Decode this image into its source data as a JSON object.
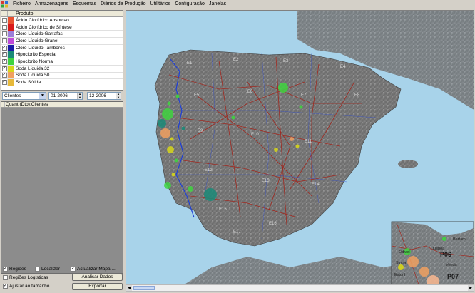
{
  "menu": {
    "items": [
      "Ficheiro",
      "Armazenagens",
      "Esquemas",
      "Diários de Produção",
      "Utilitários",
      "Configuração",
      "Janelas"
    ]
  },
  "products": {
    "header": "Produto",
    "rows": [
      {
        "label": "Ácido Clorídrico Absorcao",
        "checked": false,
        "color": "#e8512f"
      },
      {
        "label": "Ácido Clorídrico de Síntese",
        "checked": false,
        "color": "#d91a1a"
      },
      {
        "label": "Cloro Líquido Garrafas",
        "checked": false,
        "color": "#9c7fd9"
      },
      {
        "label": "Cloro Líquido Granel",
        "checked": false,
        "color": "#c04bd8"
      },
      {
        "label": "Cloro Líquido Tambores",
        "checked": true,
        "color": "#1b1ba6"
      },
      {
        "label": "Hipoclorito Especial",
        "checked": true,
        "color": "#1a8a78"
      },
      {
        "label": "Hipoclorito Normal",
        "checked": true,
        "color": "#3fd33f"
      },
      {
        "label": "Soda Líquida 32",
        "checked": true,
        "color": "#d6d61a"
      },
      {
        "label": "Soda Líquida 50",
        "checked": true,
        "color": "#f0a060"
      },
      {
        "label": "Soda Sólida",
        "checked": true,
        "color": "#e7b93a"
      }
    ]
  },
  "filter": {
    "type": "Clientes",
    "date_from": "01-2006",
    "date_to": "12-2006"
  },
  "clients_list": {
    "header": "Quant.(Dto):Clientes"
  },
  "options": {
    "regioes": {
      "label": "Regioes",
      "checked": true
    },
    "localizar": {
      "label": "Localizar",
      "checked": false
    },
    "actualizar": {
      "label": "Actualizar Mapa ...",
      "checked": true
    },
    "regioes_logisticas": {
      "label": "Regiões Logisticas",
      "checked": false
    },
    "ajustar": {
      "label": "Ajustar ao tamanho",
      "checked": true
    },
    "analisar_button": "Analisar Dados",
    "exportar_button": "Exportar"
  },
  "map": {
    "region_labels": [
      "E1",
      "E2",
      "E3",
      "E4",
      "E5",
      "E6",
      "E7",
      "E8",
      "E9",
      "E10",
      "E11",
      "E12",
      "E13",
      "E14",
      "E15",
      "E16",
      "E17"
    ],
    "inset_labels": [
      "P06",
      "P07",
      "Bartam",
      "Sintra",
      "Estoril",
      "Odivel",
      "Venda",
      "Lisboa"
    ],
    "points": [
      {
        "color": "#1a8a78",
        "size": 3
      },
      {
        "color": "#f0a060",
        "size": 3
      },
      {
        "color": "#3fd33f",
        "size": 2
      },
      {
        "color": "#d6d61a",
        "size": 2
      },
      {
        "color": "#1a8a78",
        "size": 3
      },
      {
        "color": "#3fd33f",
        "size": 2
      },
      {
        "color": "#3fd33f",
        "size": 2
      },
      {
        "color": "#d6d61a",
        "size": 1
      },
      {
        "color": "#f0a060",
        "size": 1
      },
      {
        "color": "#3fd33f",
        "size": 1
      }
    ]
  }
}
